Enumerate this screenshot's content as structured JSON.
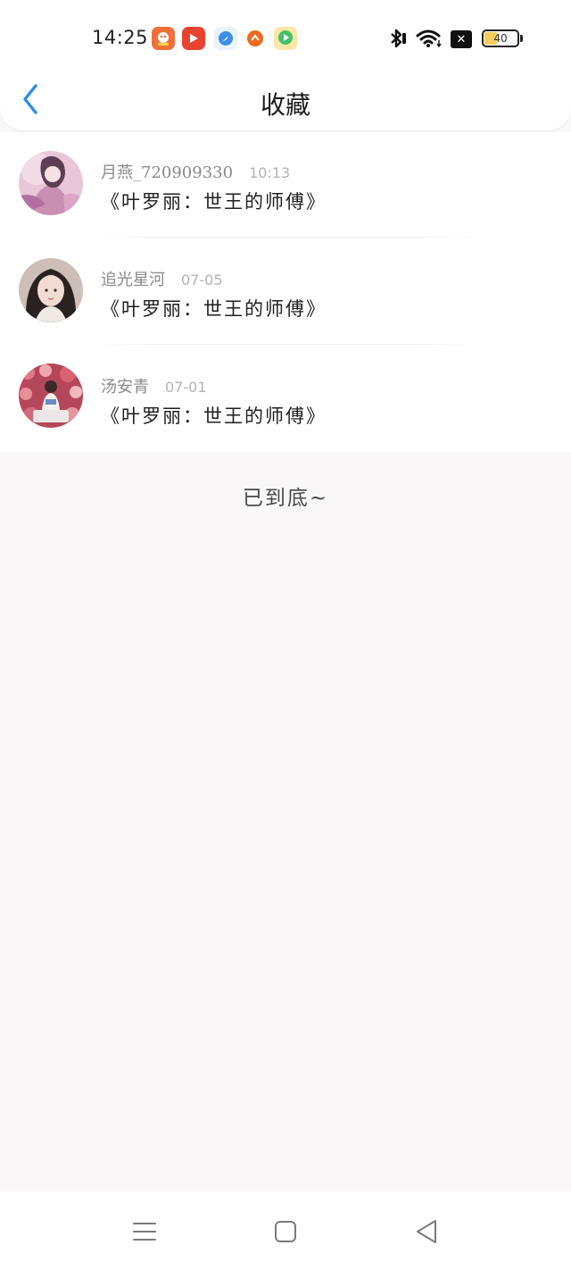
{
  "status_bar": {
    "time": "14:25",
    "apps": [
      {
        "icon": "app-icon-orange-mascot",
        "color": "#f0703a"
      },
      {
        "icon": "app-icon-red-play",
        "color": "#e8432f"
      },
      {
        "icon": "app-icon-blue-compass",
        "color": "#3b8fe8"
      },
      {
        "icon": "app-icon-orange-circle",
        "color": "#ee6a1f"
      },
      {
        "icon": "app-icon-green-play",
        "color": "#46c06a"
      }
    ],
    "battery_level": "40"
  },
  "header": {
    "title": "收藏",
    "accent_color": "#2d8ee6"
  },
  "favorites": [
    {
      "user": "月燕_720909330",
      "time": "10:13",
      "title": "《叶罗丽：世王的师傅》",
      "avatar": "avatar-anime-pink"
    },
    {
      "user": "追光星河",
      "time": "07-05",
      "title": "《叶罗丽：世王的师傅》",
      "avatar": "avatar-girl-portrait"
    },
    {
      "user": "汤安青",
      "time": "07-01",
      "title": "《叶罗丽：世王的师傅》",
      "avatar": "avatar-girl-flowers"
    }
  ],
  "footer_text": "已到底~"
}
